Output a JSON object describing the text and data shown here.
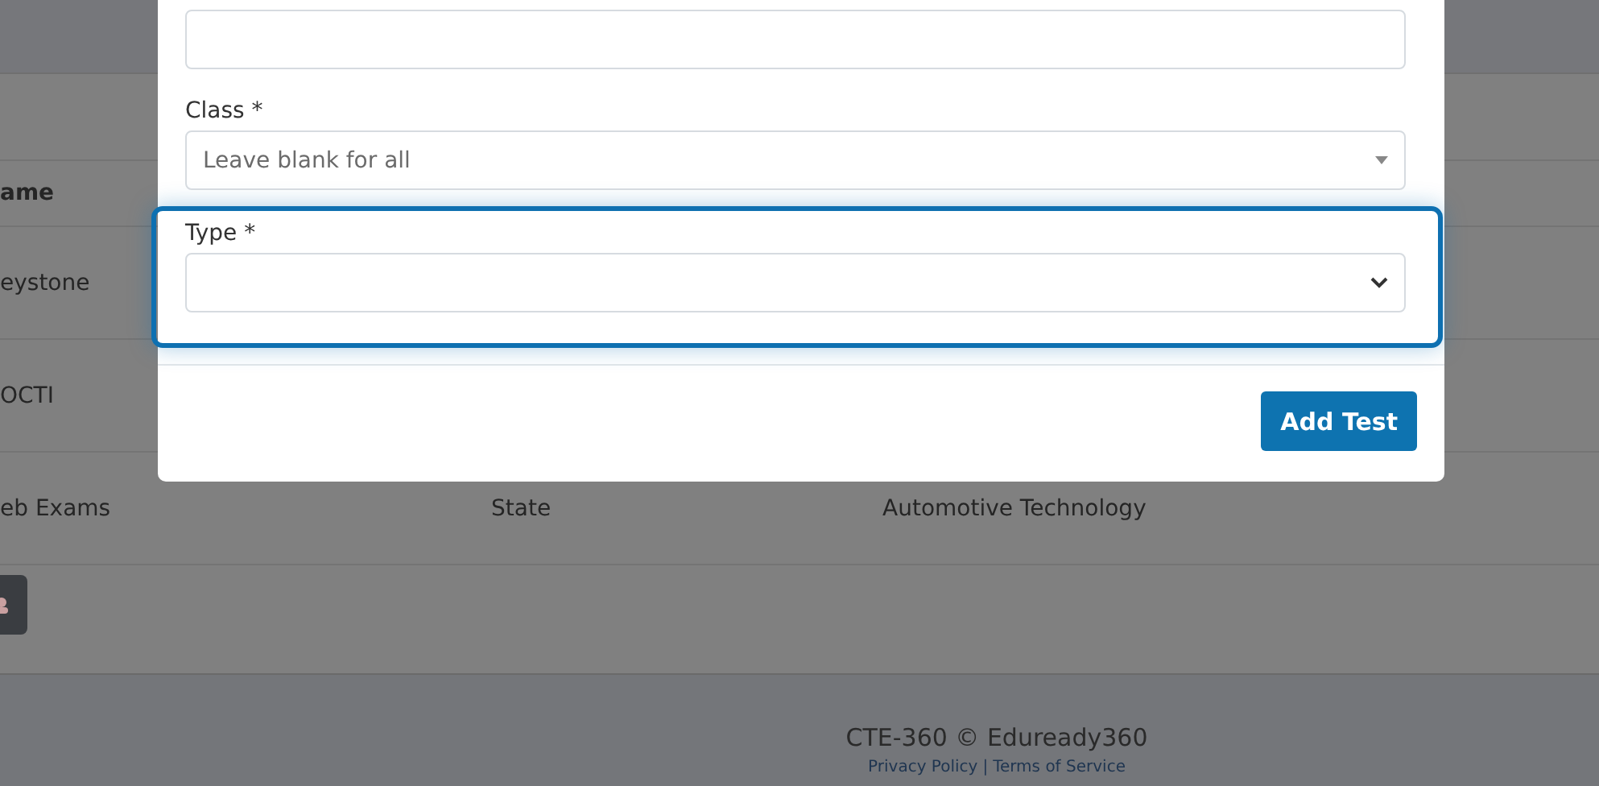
{
  "background_table": {
    "columns": [
      {
        "label": "ame"
      }
    ],
    "rows": [
      {
        "cells": [
          "eystone"
        ]
      },
      {
        "cells": [
          "OCTI"
        ]
      },
      {
        "cells": [
          "eb Exams",
          "State",
          "Automotive Technology"
        ]
      }
    ]
  },
  "modal": {
    "fields": [
      {
        "kind": "text"
      },
      {
        "kind": "combo",
        "label": "Class *",
        "placeholder": "Leave blank for all",
        "focused": false
      },
      {
        "kind": "select",
        "label": "Type *",
        "focused": true
      }
    ],
    "submit": "Add Test"
  },
  "footer": {
    "copyright": "CTE-360 © Eduready360",
    "links": [
      "Privacy Policy",
      "Terms of Service"
    ],
    "separator": "|"
  }
}
